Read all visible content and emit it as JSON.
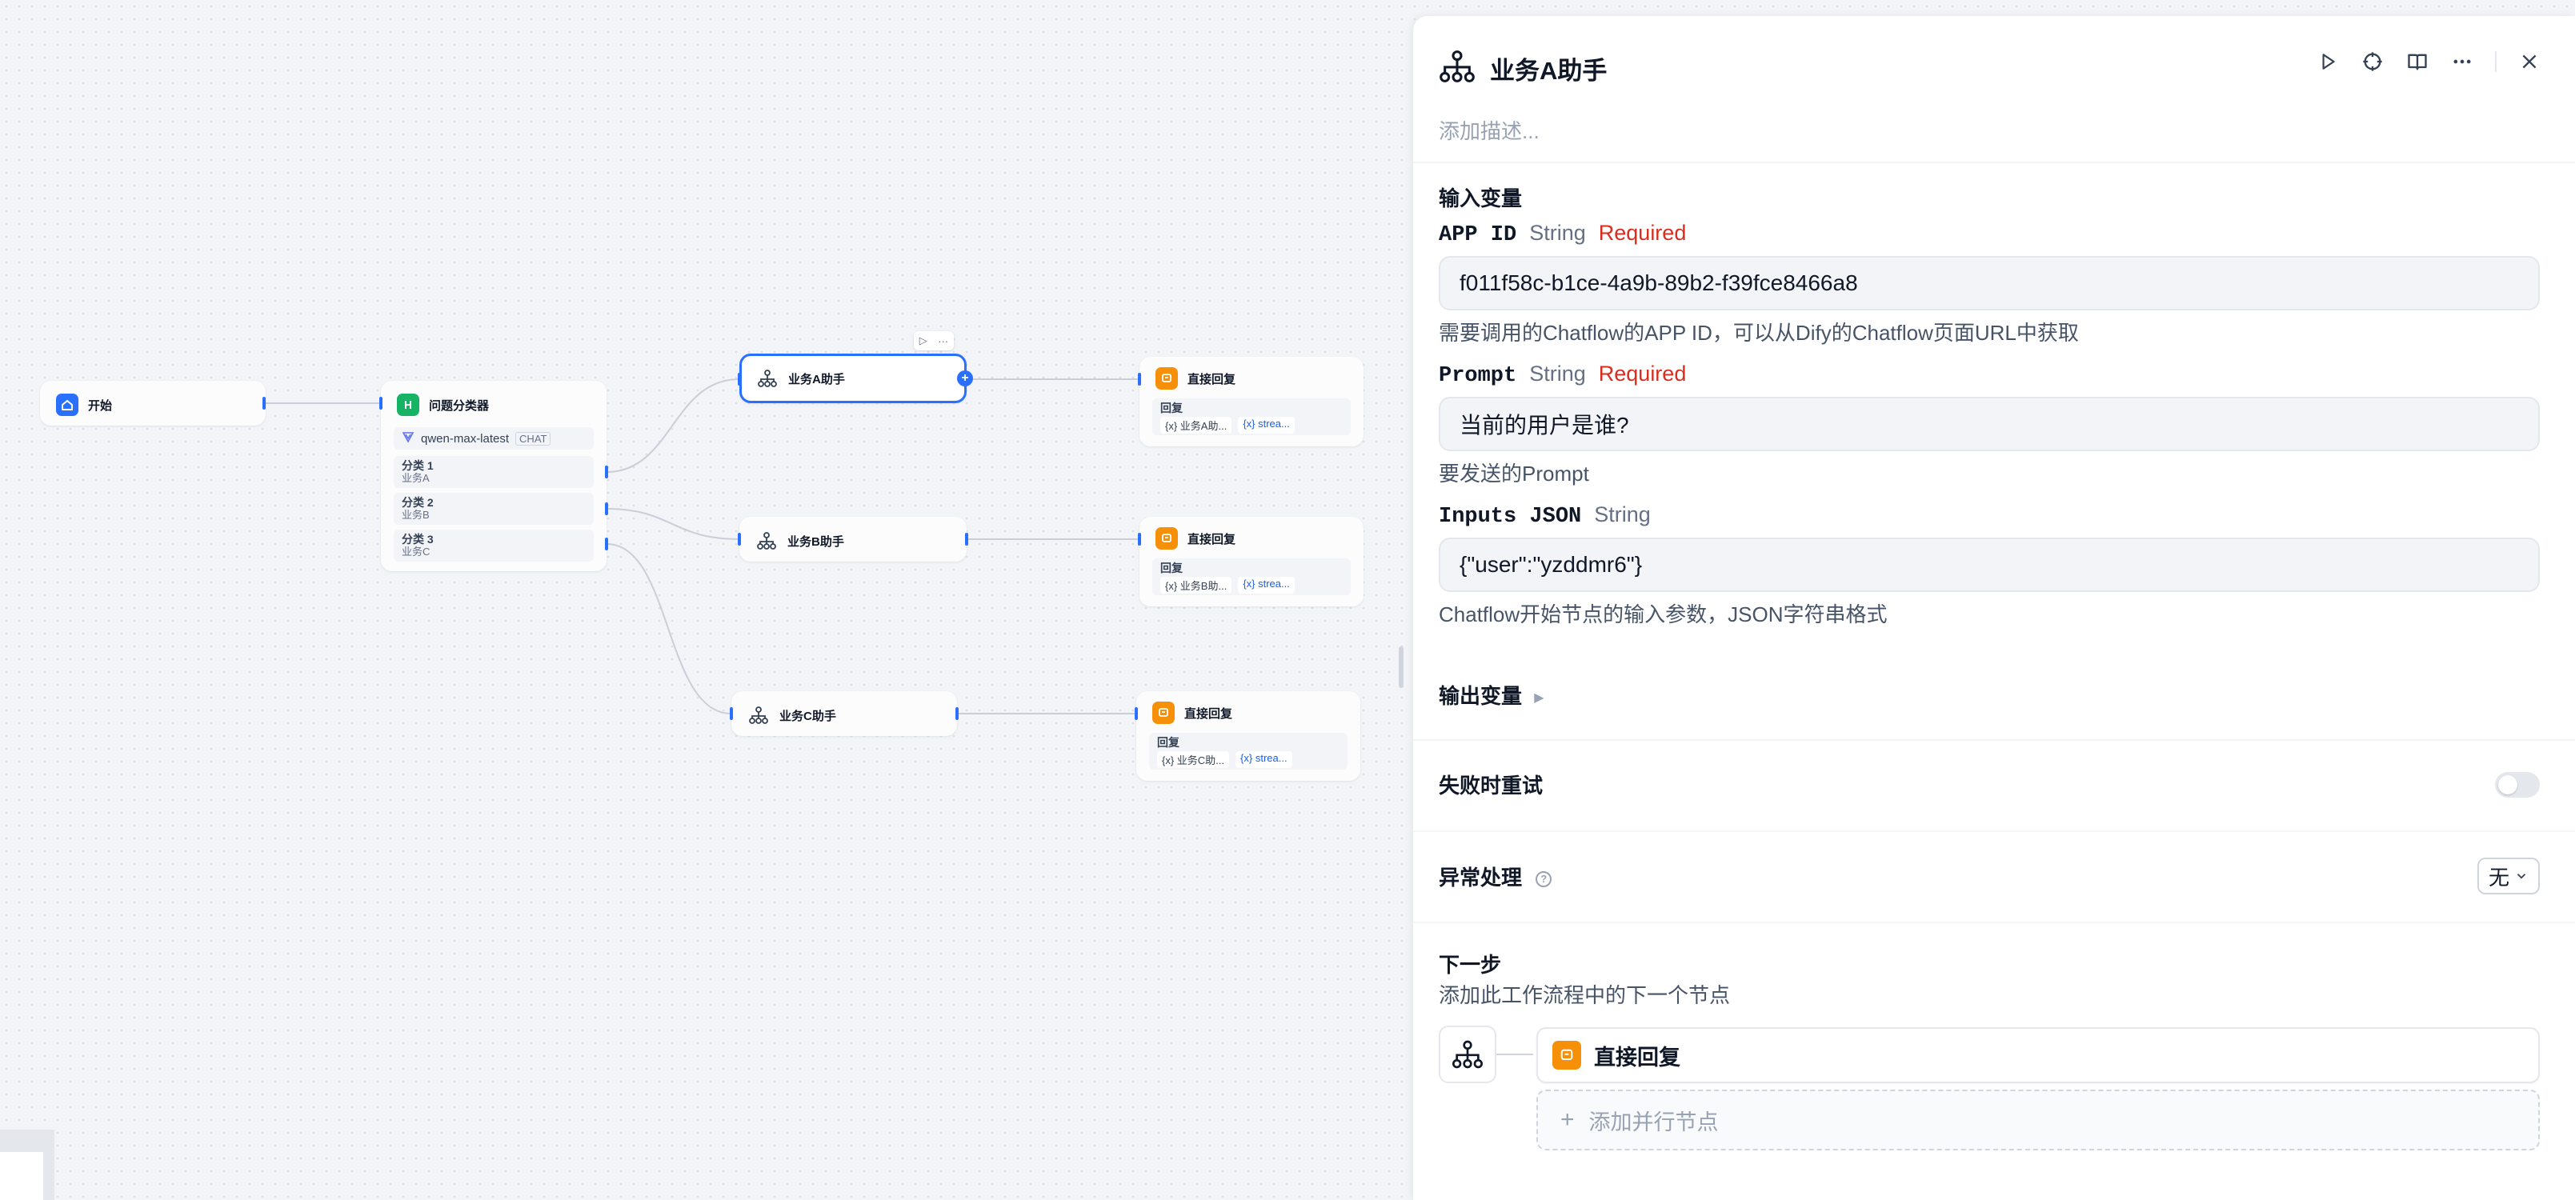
{
  "canvas": {
    "nodes": {
      "start": {
        "title": "开始"
      },
      "classifier": {
        "title": "问题分类器",
        "model": "qwen-max-latest",
        "model_tag": "CHAT",
        "classes": [
          {
            "title": "分类 1",
            "sub": "业务A"
          },
          {
            "title": "分类 2",
            "sub": "业务B"
          },
          {
            "title": "分类 3",
            "sub": "业务C"
          }
        ]
      },
      "agent_a": {
        "title": "业务A助手"
      },
      "agent_b": {
        "title": "业务B助手"
      },
      "agent_c": {
        "title": "业务C助手"
      },
      "reply_a": {
        "title": "直接回复",
        "label": "回复",
        "var1": "{x} 业务A助...",
        "var2": "{x} strea..."
      },
      "reply_b": {
        "title": "直接回复",
        "label": "回复",
        "var1": "{x} 业务B助...",
        "var2": "{x} strea..."
      },
      "reply_c": {
        "title": "直接回复",
        "label": "回复",
        "var1": "{x} 业务C助...",
        "var2": "{x} strea..."
      }
    }
  },
  "panel": {
    "title": "业务A助手",
    "description_placeholder": "添加描述...",
    "input_section_title": "输入变量",
    "fields": [
      {
        "name": "APP ID",
        "type": "String",
        "required": "Required",
        "value": "f011f58c-b1ce-4a9b-89b2-f39fce8466a8",
        "hint": "需要调用的Chatflow的APP ID，可以从Dify的Chatflow页面URL中获取"
      },
      {
        "name": "Prompt",
        "type": "String",
        "required": "Required",
        "value": "当前的用户是谁?",
        "hint": "要发送的Prompt"
      },
      {
        "name": "Inputs JSON",
        "type": "String",
        "value": "{\"user\":\"yzddmr6\"}",
        "hint": "Chatflow开始节点的输入参数，JSON字符串格式"
      }
    ],
    "output_section_title": "输出变量",
    "retry_label": "失败时重试",
    "retry_enabled": false,
    "error_handling_label": "异常处理",
    "error_handling_value": "无",
    "next_step_title": "下一步",
    "next_step_desc": "添加此工作流程中的下一个节点",
    "next_node_label": "直接回复",
    "add_parallel_label": "添加并行节点"
  },
  "colors": {
    "accent": "#2970ff",
    "required": "#d92d20",
    "classifier": "#16b364",
    "reply": "#f79009"
  }
}
